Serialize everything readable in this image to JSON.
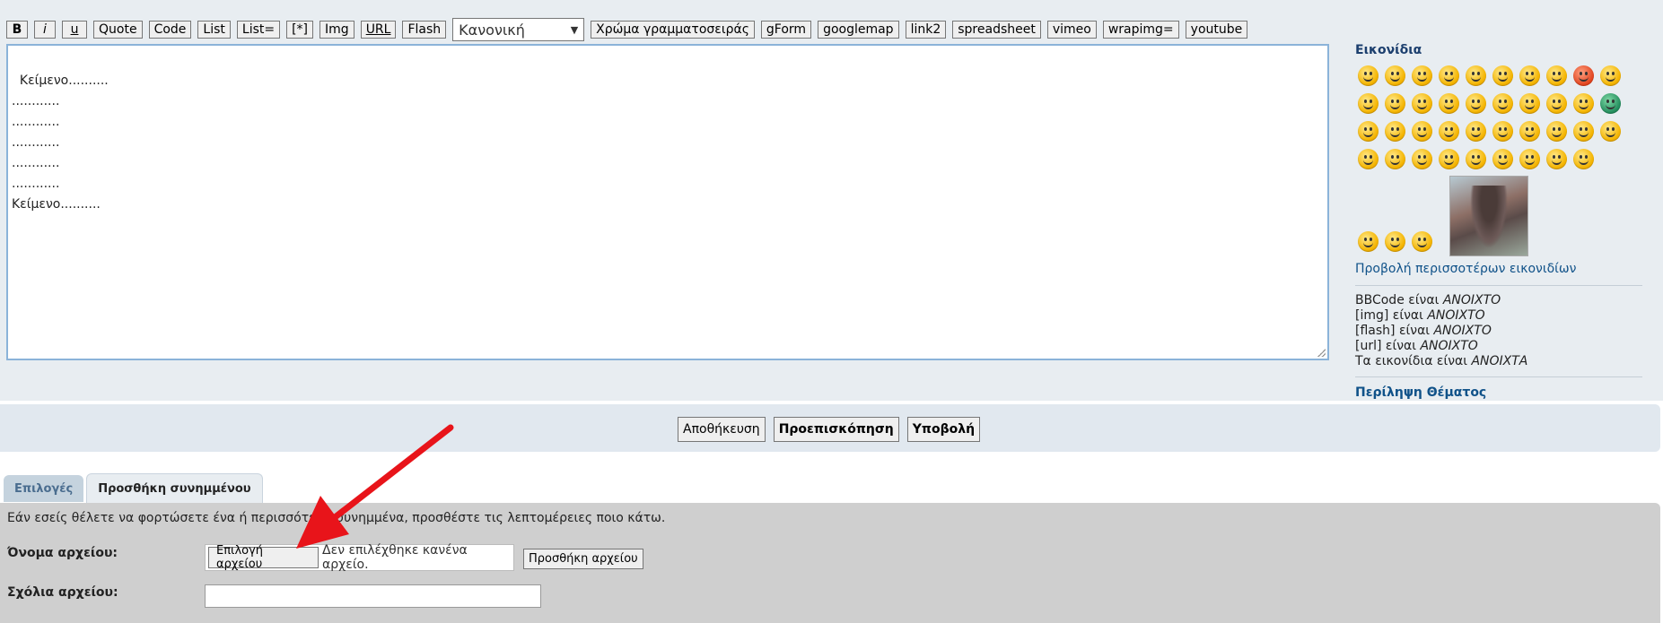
{
  "toolbar": {
    "bold": "B",
    "italic": "i",
    "underline": "u",
    "quote": "Quote",
    "code": "Code",
    "list": "List",
    "list_eq": "List=",
    "list_item": "[*]",
    "img": "Img",
    "url": "URL",
    "flash": "Flash",
    "font_size_selected": "Κανονική",
    "font_color": "Χρώμα γραμματοσειράς",
    "gform": "gForm",
    "googlemap": "googlemap",
    "link2": "link2",
    "spreadsheet": "spreadsheet",
    "vimeo": "vimeo",
    "wrapimg": "wrapimg=",
    "youtube": "youtube"
  },
  "editor": {
    "text": "Κείμενο..........\n............\n............\n............\n............\n............\nΚείμενο.........."
  },
  "sidebar": {
    "smilies_title": "Εικονίδια",
    "more_smilies": "Προβολή περισσοτέρων εικονιδίων",
    "bbcode_label": "BBCode είναι",
    "bbcode_state": "ΑΝΟΙΧΤΟ",
    "img_label": "[img] είναι",
    "img_state": "ΑΝΟΙΧΤΟ",
    "flash_label": "[flash] είναι",
    "flash_state": "ΑΝΟΙΧΤΟ",
    "url_label": "[url] είναι",
    "url_state": "ΑΝΟΙΧΤΟ",
    "smilies_label": "Τα εικονίδια είναι",
    "smilies_state": "ΑΝΟΙΧΤΑ",
    "topic_review": "Περίληψη Θέματος"
  },
  "submit_bar": {
    "save": "Αποθήκευση",
    "preview": "Προεπισκόπηση",
    "submit": "Υποβολή"
  },
  "tabs": {
    "options": "Επιλογές",
    "add_attachment": "Προσθήκη συνημμένου"
  },
  "attachments": {
    "intro": "Εάν εσείς θέλετε να φορτώσετε ένα ή περισσότερα συνημμένα, προσθέστε τις λεπτομέρειες ποιο κάτω.",
    "filename_label": "Όνομα αρχείου:",
    "choose_file": "Επιλογή αρχείου",
    "no_file": "Δεν επιλέχθηκε κανένα αρχείο.",
    "add_file": "Προσθήκη αρχείου",
    "comment_label": "Σχόλια αρχείου:"
  },
  "annotation": {
    "arrow_color": "#e8141a"
  }
}
